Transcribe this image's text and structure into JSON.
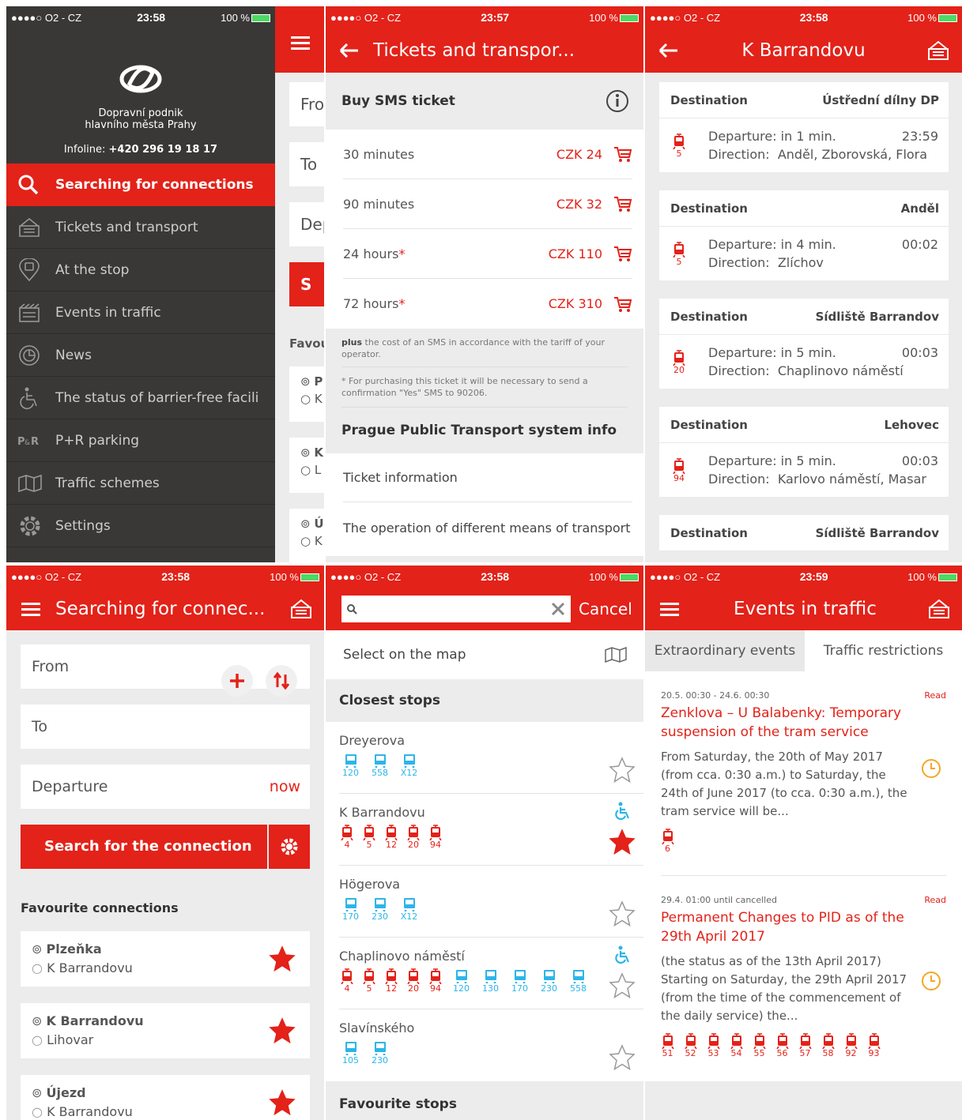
{
  "status": {
    "p1": {
      "carrier": "●●●●○ O2 - CZ",
      "time": "23:58",
      "battery": "100 %"
    },
    "p2": {
      "carrier": "●●●●○ O2 - CZ",
      "time": "23:57",
      "battery": "100 %"
    },
    "p3": {
      "carrier": "●●●●○ O2 - CZ",
      "time": "23:58",
      "battery": "100 %"
    },
    "p4": {
      "carrier": "●●●●○ O2 - CZ",
      "time": "23:58",
      "battery": "100 %"
    },
    "p5": {
      "carrier": "●●●●○ O2 - CZ",
      "time": "23:58",
      "battery": "100 %"
    },
    "p6": {
      "carrier": "●●●●○ O2 - CZ",
      "time": "23:59",
      "battery": "100 %"
    }
  },
  "drawer": {
    "org_line1": "Dopravní podnik",
    "org_line2": "hlavního města Prahy",
    "infoline_label": "Infoline:",
    "infoline_number": "+420 296 19 18 17",
    "items": [
      {
        "label": "Searching for connections",
        "icon": "search-icon"
      },
      {
        "label": "Tickets and transport",
        "icon": "ticket-icon"
      },
      {
        "label": "At the stop",
        "icon": "stop-pin-icon"
      },
      {
        "label": "Events in traffic",
        "icon": "events-icon"
      },
      {
        "label": "News",
        "icon": "news-icon"
      },
      {
        "label": "The status of barrier-free facili",
        "icon": "wheelchair-icon"
      },
      {
        "label": "P+R parking",
        "icon": "pr-parking-icon"
      },
      {
        "label": "Traffic schemes",
        "icon": "map-icon"
      },
      {
        "label": "Settings",
        "icon": "gear-icon"
      }
    ],
    "behind": {
      "from": "Fro",
      "to": "To",
      "dep": "Dep",
      "search": "S",
      "fav": "Favou",
      "rows": [
        [
          "P",
          "K"
        ],
        [
          "K",
          "L"
        ],
        [
          "Ú",
          "K"
        ]
      ]
    }
  },
  "tickets": {
    "title": "Tickets and transpor...",
    "sms_heading": "Buy SMS ticket",
    "rows": [
      {
        "label": "30 minutes",
        "star": "",
        "price": "CZK 24"
      },
      {
        "label": "90 minutes",
        "star": "",
        "price": "CZK 32"
      },
      {
        "label": "24 hours",
        "star": "*",
        "price": "CZK 110"
      },
      {
        "label": "72 hours",
        "star": "*",
        "price": "CZK 310"
      }
    ],
    "note1_bold": "plus",
    "note1": " the cost of an SMS in accordance with the tariff of your operator.",
    "note2": "* For purchasing this ticket it will be necessary to send a confirmation \"Yes\" SMS to 90206.",
    "info_heading": "Prague Public Transport system info",
    "info_items": [
      "Ticket information",
      "The operation of different means of transport"
    ]
  },
  "stop": {
    "title": "K Barrandovu",
    "dest_label": "Destination",
    "dep_label": "Departure:",
    "dir_label": "Direction:",
    "departures": [
      {
        "dest": "Ústřední dílny DP",
        "line": "5",
        "dep": "in 1 min.",
        "time": "23:59",
        "dir": "Anděl, Zborovská, Flora"
      },
      {
        "dest": "Anděl",
        "line": "5",
        "dep": "in 4 min.",
        "time": "00:02",
        "dir": "Zlíchov"
      },
      {
        "dest": "Sídliště Barrandov",
        "line": "20",
        "dep": "in 5 min.",
        "time": "00:03",
        "dir": "Chaplinovo náměstí"
      },
      {
        "dest": "Lehovec",
        "line": "94",
        "dep": "in 5 min.",
        "time": "00:03",
        "dir": "Karlovo náměstí, Masar"
      },
      {
        "dest": "Sídliště Barrandov"
      }
    ]
  },
  "search": {
    "title": "Searching for connec...",
    "from": "From",
    "to": "To",
    "departure": "Departure",
    "now": "now",
    "button": "Search for the connection",
    "fav_heading": "Favourite connections",
    "favs": [
      {
        "from": "Plzeňka",
        "to": "K Barrandovu"
      },
      {
        "from": "K Barrandovu",
        "to": "Lihovar"
      },
      {
        "from": "Újezd",
        "to": "K Barrandovu"
      }
    ]
  },
  "stops": {
    "search_value": "",
    "cancel": "Cancel",
    "map_select": "Select on the map",
    "closest_heading": "Closest stops",
    "list": [
      {
        "name": "Dreyerova",
        "wheel": false,
        "fav": false,
        "lines": [
          {
            "n": "120",
            "t": "bus"
          },
          {
            "n": "558",
            "t": "bus"
          },
          {
            "n": "X12",
            "t": "bus"
          }
        ]
      },
      {
        "name": "K Barrandovu",
        "wheel": true,
        "fav": true,
        "lines": [
          {
            "n": "4",
            "t": "tram"
          },
          {
            "n": "5",
            "t": "tram"
          },
          {
            "n": "12",
            "t": "tram"
          },
          {
            "n": "20",
            "t": "tram"
          },
          {
            "n": "94",
            "t": "tram"
          }
        ]
      },
      {
        "name": "Högerova",
        "wheel": false,
        "fav": false,
        "lines": [
          {
            "n": "170",
            "t": "bus"
          },
          {
            "n": "230",
            "t": "bus"
          },
          {
            "n": "X12",
            "t": "bus"
          }
        ]
      },
      {
        "name": "Chaplinovo náměstí",
        "wheel": true,
        "fav": false,
        "lines": [
          {
            "n": "4",
            "t": "tram"
          },
          {
            "n": "5",
            "t": "tram"
          },
          {
            "n": "12",
            "t": "tram"
          },
          {
            "n": "20",
            "t": "tram"
          },
          {
            "n": "94",
            "t": "tram"
          },
          {
            "n": "120",
            "t": "bus"
          },
          {
            "n": "130",
            "t": "bus"
          },
          {
            "n": "170",
            "t": "bus"
          },
          {
            "n": "230",
            "t": "bus"
          },
          {
            "n": "558",
            "t": "bus"
          }
        ]
      },
      {
        "name": "Slavínského",
        "wheel": false,
        "fav": false,
        "lines": [
          {
            "n": "105",
            "t": "bus"
          },
          {
            "n": "230",
            "t": "bus"
          }
        ]
      }
    ],
    "fav_heading": "Favourite stops"
  },
  "events": {
    "title": "Events in traffic",
    "tabs": [
      "Extraordinary events",
      "Traffic restrictions"
    ],
    "items": [
      {
        "date": "20.5. 00:30 - 24.6. 00:30",
        "read": "Read",
        "title": "Zenklova – U Balabenky: Temporary suspension of the tram service",
        "body": "From Saturday, the 20th of May 2017 (from cca. 0:30 a.m.) to Saturday, the 24th of June 2017 (to cca. 0:30 a.m.), the tram service will be...",
        "lines": [
          "6"
        ]
      },
      {
        "date": "29.4. 01:00 until cancelled",
        "read": "Read",
        "title": "Permanent Changes to PID as of the 29th April 2017",
        "body": "(the status as of the 13th April 2017) Starting on Saturday, the 29th April 2017 (from the time of the commencement of the daily service) the...",
        "lines": [
          "51",
          "52",
          "53",
          "54",
          "55",
          "56",
          "57",
          "58",
          "92",
          "93"
        ]
      }
    ]
  },
  "colors": {
    "red": "#e32219",
    "dark": "#3a3836",
    "blue": "#2cb5e8",
    "orange": "#f5a623"
  }
}
